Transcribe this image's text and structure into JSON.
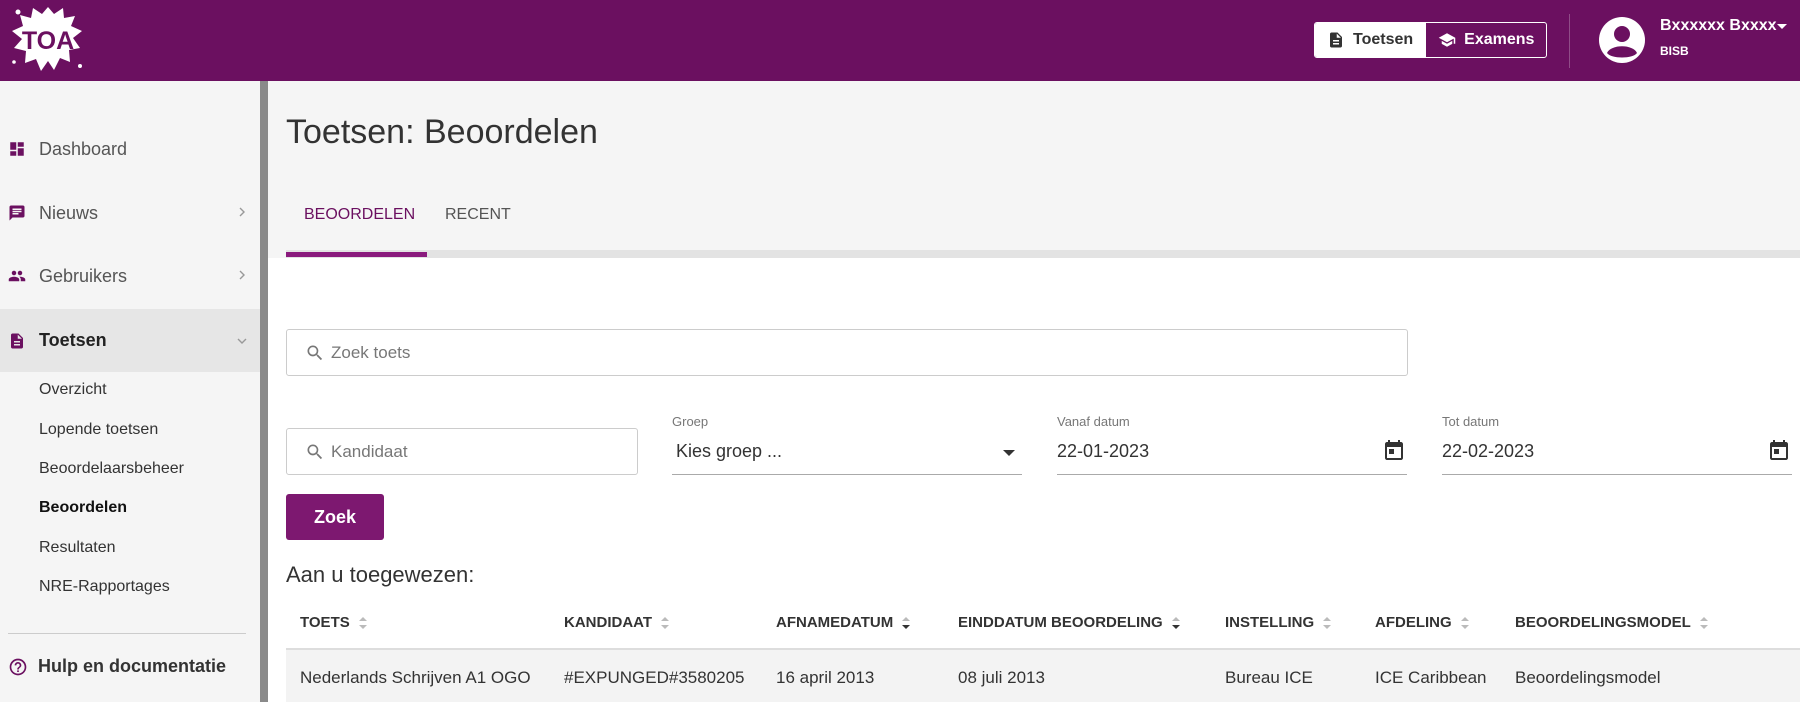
{
  "header": {
    "logo_text": "TOA",
    "toggle": {
      "tests_label": "Toetsen",
      "exams_label": "Examens"
    },
    "user": {
      "name": "Bxxxxxx Bxxxx",
      "org": "BISB"
    }
  },
  "sidebar": {
    "items": [
      {
        "label": "Dashboard",
        "icon": "dashboard-icon"
      },
      {
        "label": "Nieuws",
        "icon": "chat-icon"
      },
      {
        "label": "Gebruikers",
        "icon": "people-icon"
      },
      {
        "label": "Toetsen",
        "icon": "document-icon"
      }
    ],
    "subitems": [
      "Overzicht",
      "Lopende toetsen",
      "Beoordelaarsbeheer",
      "Beoordelen",
      "Resultaten",
      "NRE-Rapportages"
    ],
    "help_label": "Hulp en documentatie"
  },
  "page": {
    "title": "Toetsen: Beoordelen",
    "tabs": [
      "BEOORDELEN",
      "RECENT"
    ]
  },
  "filters": {
    "search_placeholder": "Zoek toets",
    "candidate_placeholder": "Kandidaat",
    "group_label": "Groep",
    "group_value": "Kies groep ...",
    "from_label": "Vanaf datum",
    "from_value": "22-01-2023",
    "to_label": "Tot datum",
    "to_value": "22-02-2023",
    "search_button": "Zoek"
  },
  "assigned": {
    "title": "Aan u toegewezen:",
    "columns": [
      "TOETS",
      "KANDIDAAT",
      "AFNAMEDATUM",
      "EINDDATUM BEOORDELING",
      "INSTELLING",
      "AFDELING",
      "BEOORDELINGSMODEL"
    ],
    "rows": [
      [
        "Nederlands Schrijven A1 OGO",
        "#EXPUNGED#3580205",
        "16 april 2013",
        "08 juli 2013",
        "Bureau ICE",
        "ICE Caribbean",
        "Beoordelingsmodel"
      ]
    ]
  },
  "colors": {
    "brand": "#6b1060",
    "accent": "#8a1a7d"
  }
}
